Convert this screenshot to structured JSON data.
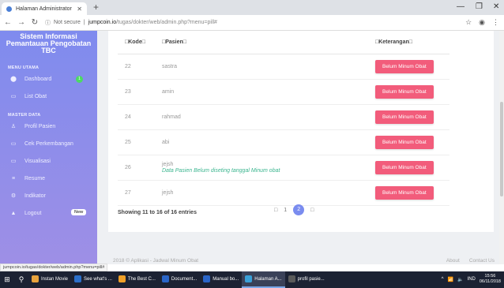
{
  "browser": {
    "tab_title": "Halaman Administrator",
    "security": "Not secure",
    "url_host": "jumpcoin.io",
    "url_path": "/tugas/dokter/web/admin.php?menu=pill#"
  },
  "sidebar": {
    "brand": "Sistem Informasi Pemantauan Pengobatan TBC",
    "section_main": "MENU UTAMA",
    "section_master": "MASTER DATA",
    "items": [
      {
        "label": "Dashboard",
        "icon": "palette-icon",
        "glyph": "⬤",
        "badge": "1"
      },
      {
        "label": "List Obat",
        "icon": "folder-icon",
        "glyph": "▭"
      },
      {
        "label": "Profil Pasien",
        "icon": "user-icon",
        "glyph": "♙"
      },
      {
        "label": "Cek Perkembangan",
        "icon": "folder-icon",
        "glyph": "▭"
      },
      {
        "label": "Visualisasi",
        "icon": "folder-icon",
        "glyph": "▭"
      },
      {
        "label": "Resume",
        "icon": "list-icon",
        "glyph": "≡"
      },
      {
        "label": "Indikator",
        "icon": "settings-icon",
        "glyph": "⚙"
      },
      {
        "label": "Logout",
        "icon": "lock-icon",
        "glyph": "▲",
        "badge": "New"
      }
    ]
  },
  "table": {
    "headers": [
      "□Kode□",
      "□Pasien□",
      "□Keterangan□"
    ],
    "rows": [
      {
        "kode": "22",
        "pasien": "sastra",
        "note": "",
        "status": "Belum Minum Obat"
      },
      {
        "kode": "23",
        "pasien": "amin",
        "note": "",
        "status": "Belum Minum Obat"
      },
      {
        "kode": "24",
        "pasien": "rahmad",
        "note": "",
        "status": "Belum Minum Obat"
      },
      {
        "kode": "25",
        "pasien": "abi",
        "note": "",
        "status": "Belum Minum Obat"
      },
      {
        "kode": "26",
        "pasien": "jejsh",
        "note": "Data Pasien Belum diseting tanggal Minum obat",
        "status": "Belum Minum Obat"
      },
      {
        "kode": "27",
        "pasien": "jejsh",
        "note": "",
        "status": "Belum Minum Obat"
      }
    ],
    "entries_info": "Showing 11 to 16 of 16 entries"
  },
  "pagination": {
    "prev": "□",
    "pages": [
      "1",
      "2"
    ],
    "current": "2",
    "next": "□"
  },
  "footer": {
    "left": "2018 © Aplikasi - Jadwal Minum Obat",
    "about": "About",
    "contact": "Contact Us"
  },
  "status_url": "jumpcoin.io/tugas/dokter/web/admin.php?menu=pill#",
  "taskbar": {
    "apps": [
      "Instan Movie",
      "See what's ...",
      "The Best C...",
      "Document...",
      "Manual bo...",
      "Halaman A...",
      "profil pasie..."
    ],
    "lang": "IND",
    "time": "15:56",
    "date": "06/11/2018"
  }
}
